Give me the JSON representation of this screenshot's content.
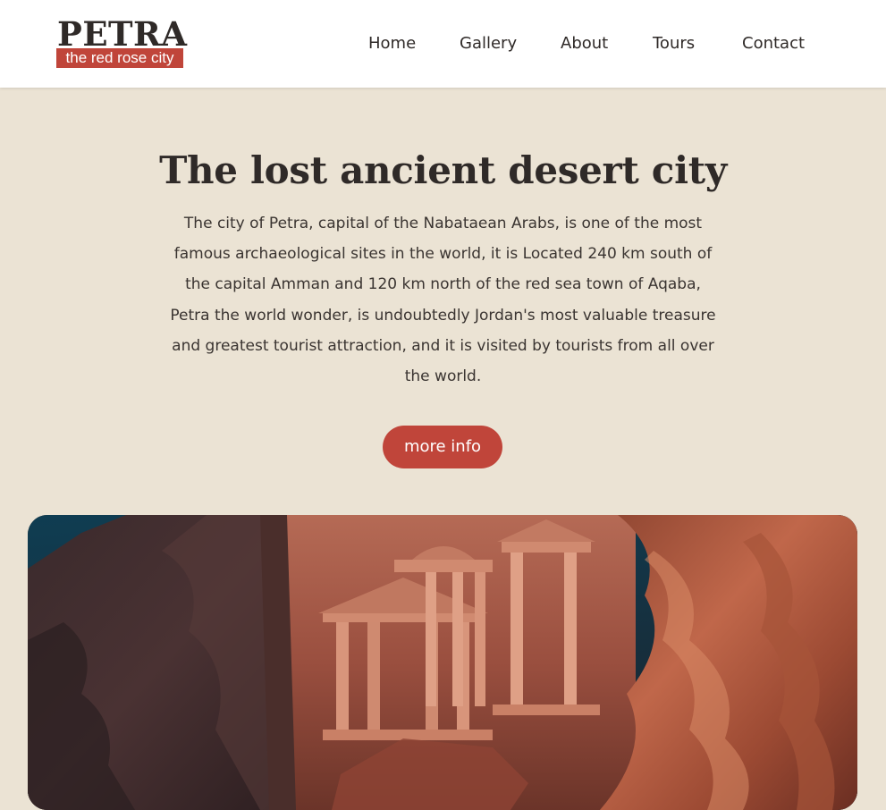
{
  "header": {
    "logo": {
      "title": "PETRA",
      "tagline": "the red rose city"
    },
    "nav": [
      {
        "label": "Home"
      },
      {
        "label": "Gallery"
      },
      {
        "label": "About"
      },
      {
        "label": "Tours"
      },
      {
        "label": "Contact"
      }
    ]
  },
  "hero": {
    "title": "The lost ancient desert city",
    "paragraph": "The city of Petra, capital of the Nabataean Arabs, is one of the most famous archaeological sites in the world, it is Located 240 km south of the capital Amman and 120 km north of the red sea town of Aqaba, Petra the world wonder, is undoubtedly Jordan's most valuable treasure and greatest tourist attraction, and it is visited by tourists from all over the world.",
    "button_label": "more info",
    "image_icon": "petra-treasury-photo"
  },
  "colors": {
    "accent": "#C0453A",
    "background": "#EBE3D4",
    "header_bg": "#FFFFFF",
    "text_dark": "#2F2A28"
  }
}
